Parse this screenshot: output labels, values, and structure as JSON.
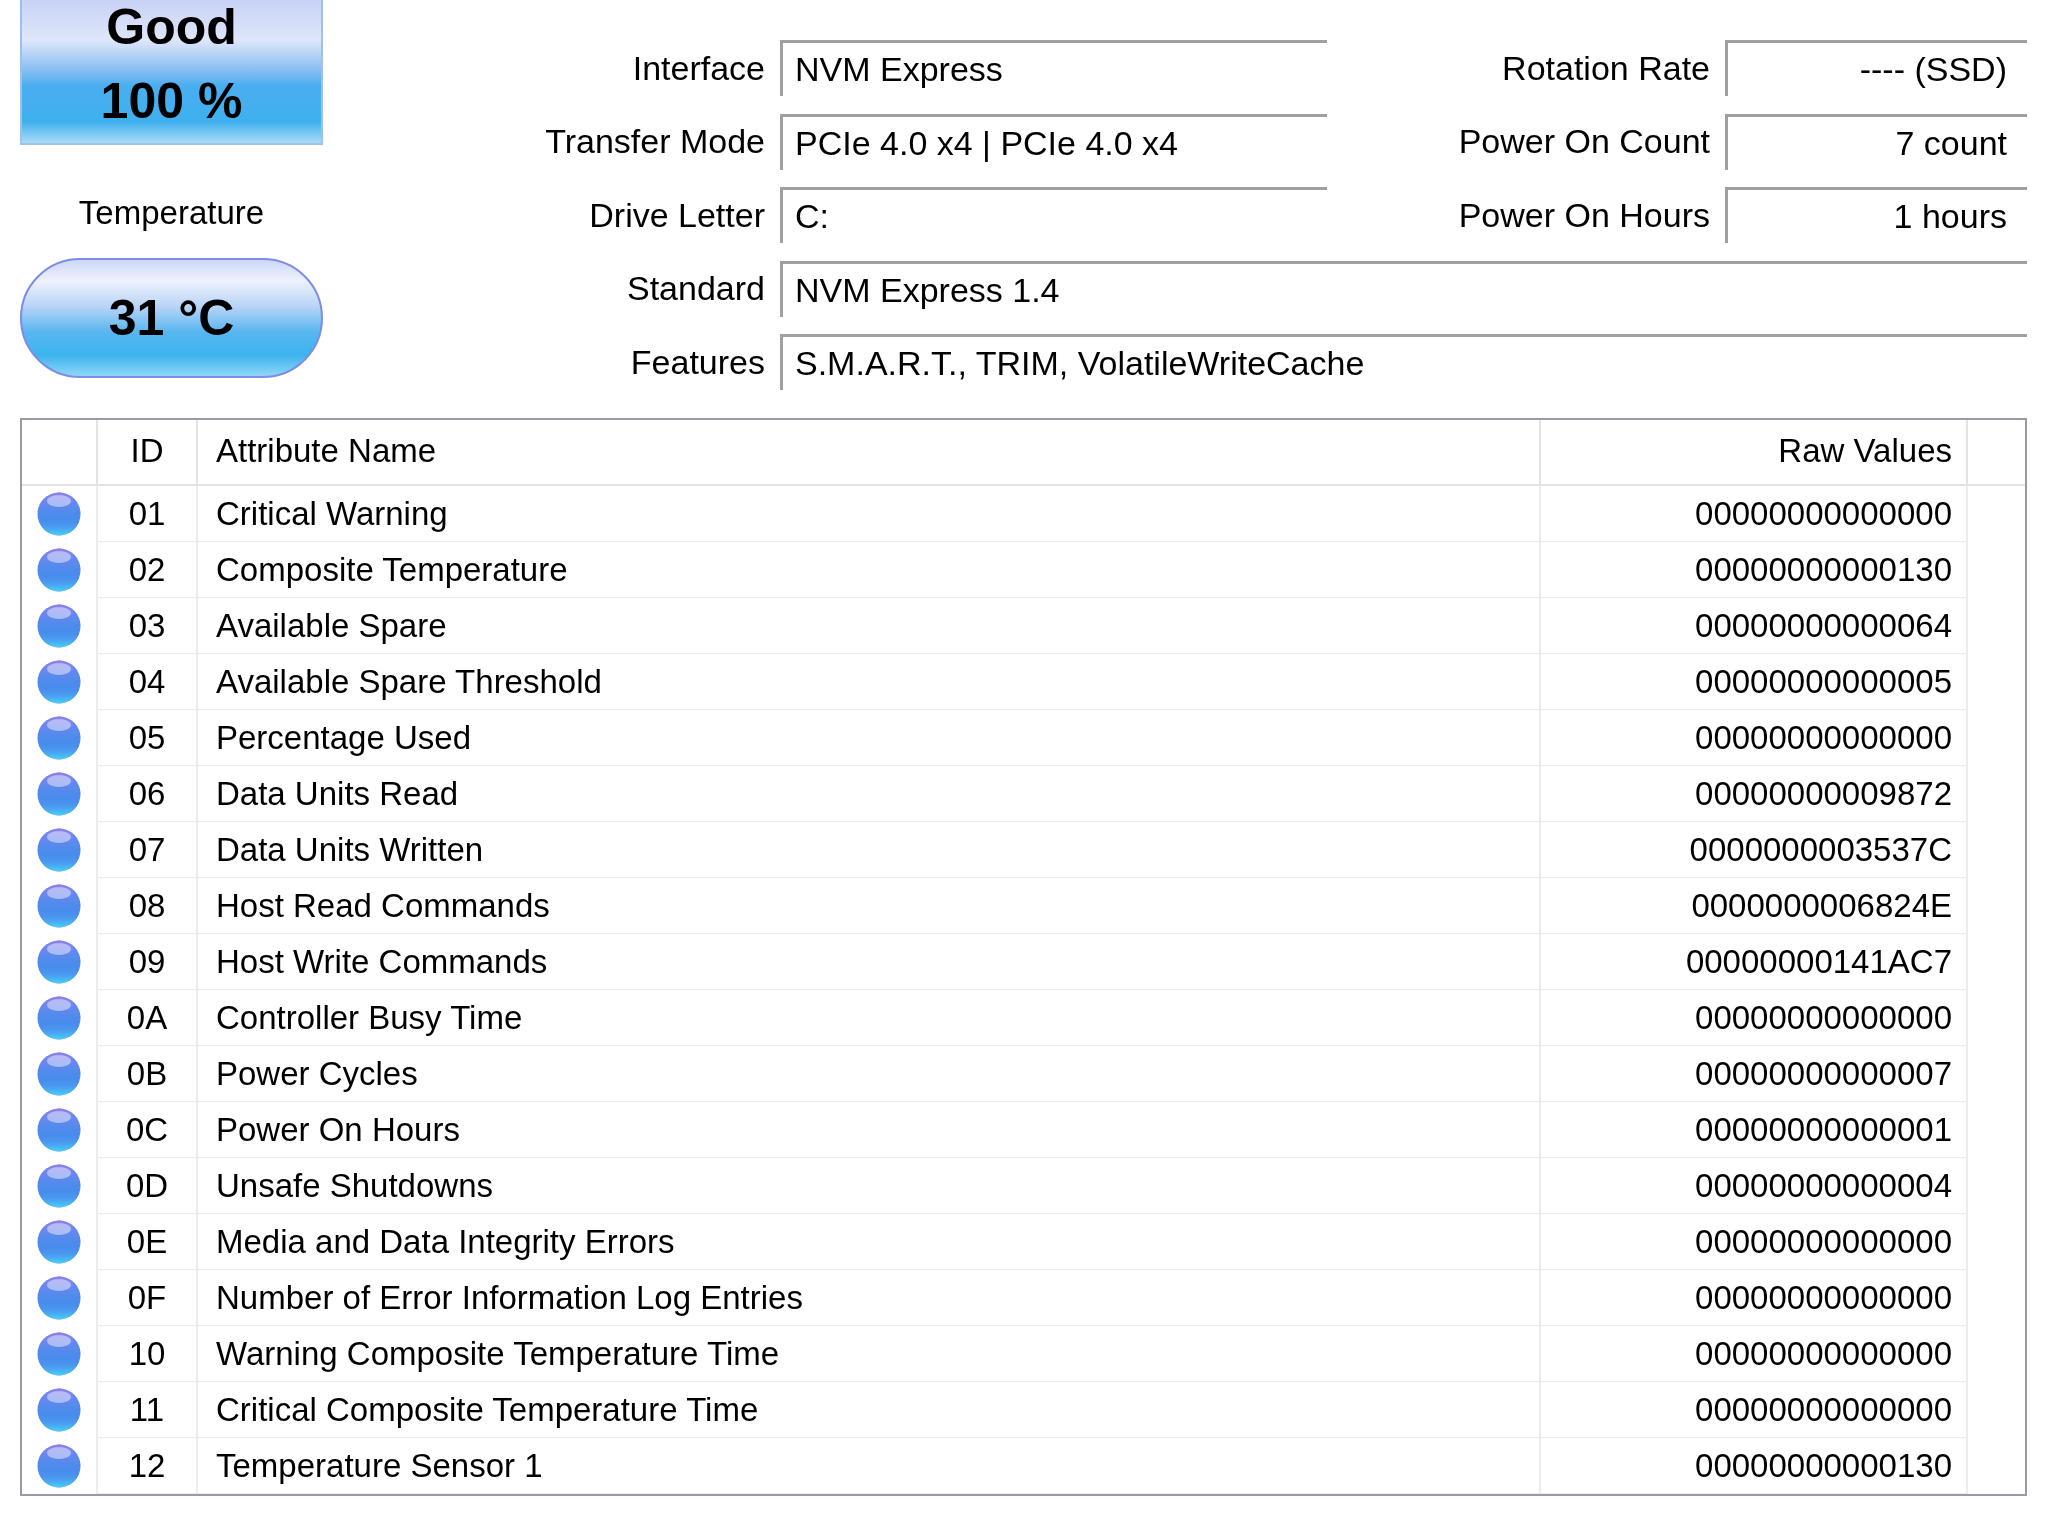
{
  "health": {
    "status": "Good",
    "percentage": "100 %"
  },
  "temperature": {
    "label": "Temperature",
    "value": "31 °C"
  },
  "info_rows": [
    [
      {
        "label": "Interface",
        "value": "NVM Express"
      },
      {
        "label": "Rotation Rate",
        "value": "---- (SSD)"
      }
    ],
    [
      {
        "label": "Transfer Mode",
        "value": "PCIe 4.0 x4 | PCIe 4.0 x4"
      },
      {
        "label": "Power On Count",
        "value": "7 count"
      }
    ],
    [
      {
        "label": "Drive Letter",
        "value": "C:"
      },
      {
        "label": "Power On Hours",
        "value": "1 hours"
      }
    ],
    [
      {
        "label": "Standard",
        "value": "NVM Express 1.4"
      }
    ],
    [
      {
        "label": "Features",
        "value": "S.M.A.R.T., TRIM, VolatileWriteCache"
      }
    ]
  ],
  "table": {
    "columns": [
      "ID",
      "Attribute Name",
      "Raw Values"
    ],
    "rows": [
      {
        "color": "#4a8cec",
        "id": "01",
        "name": "Critical Warning",
        "raw": "00000000000000"
      },
      {
        "color": "#4a8cec",
        "id": "02",
        "name": "Composite Temperature",
        "raw": "00000000000130"
      },
      {
        "color": "#4a8cec",
        "id": "03",
        "name": "Available Spare",
        "raw": "00000000000064"
      },
      {
        "color": "#4a8cec",
        "id": "04",
        "name": "Available Spare Threshold",
        "raw": "00000000000005"
      },
      {
        "color": "#4a8cec",
        "id": "05",
        "name": "Percentage Used",
        "raw": "00000000000000"
      },
      {
        "color": "#4a8cec",
        "id": "06",
        "name": "Data Units Read",
        "raw": "00000000009872"
      },
      {
        "color": "#4a8cec",
        "id": "07",
        "name": "Data Units Written",
        "raw": "0000000003537C"
      },
      {
        "color": "#4a8cec",
        "id": "08",
        "name": "Host Read Commands",
        "raw": "0000000006824E"
      },
      {
        "color": "#4a8cec",
        "id": "09",
        "name": "Host Write Commands",
        "raw": "00000000141AC7"
      },
      {
        "color": "#4a8cec",
        "id": "0A",
        "name": "Controller Busy Time",
        "raw": "00000000000000"
      },
      {
        "color": "#4a8cec",
        "id": "0B",
        "name": "Power Cycles",
        "raw": "00000000000007"
      },
      {
        "color": "#4a8cec",
        "id": "0C",
        "name": "Power On Hours",
        "raw": "00000000000001"
      },
      {
        "color": "#4a8cec",
        "id": "0D",
        "name": "Unsafe Shutdowns",
        "raw": "00000000000004"
      },
      {
        "color": "#4a8cec",
        "id": "0E",
        "name": "Media and Data Integrity Errors",
        "raw": "00000000000000"
      },
      {
        "color": "#4a8cec",
        "id": "0F",
        "name": "Number of Error Information Log Entries",
        "raw": "00000000000000"
      },
      {
        "color": "#4a8cec",
        "id": "10",
        "name": "Warning Composite Temperature Time",
        "raw": "00000000000000"
      },
      {
        "color": "#4a8cec",
        "id": "11",
        "name": "Critical Composite Temperature Time",
        "raw": "00000000000000"
      },
      {
        "color": "#4a8cec",
        "id": "12",
        "name": "Temperature Sensor 1",
        "raw": "00000000000130"
      }
    ]
  }
}
